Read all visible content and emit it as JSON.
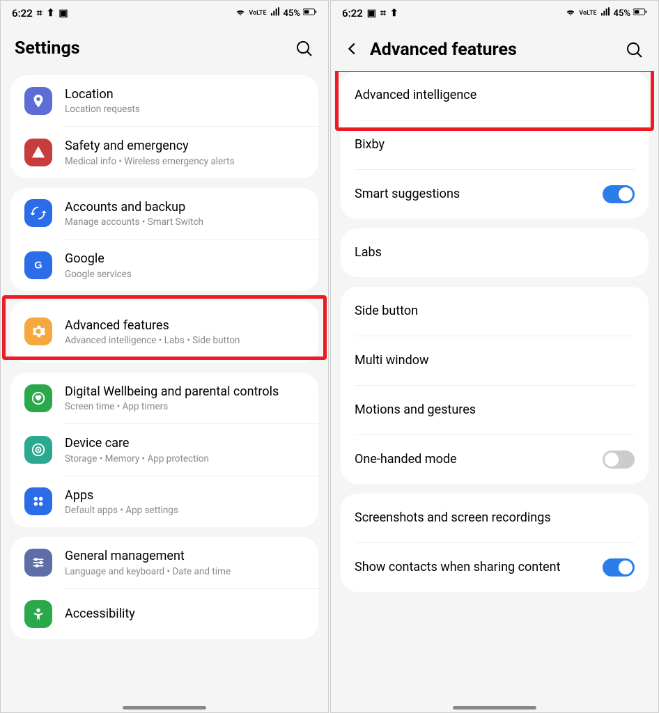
{
  "status": {
    "time": "6:22",
    "battery": "45%",
    "volte": "VoLTE"
  },
  "left": {
    "title": "Settings",
    "groups": [
      {
        "rows": [
          {
            "id": "location",
            "title": "Location",
            "sub": "Location requests",
            "icon": "location",
            "color": "ic-blue"
          },
          {
            "id": "safety",
            "title": "Safety and emergency",
            "sub": "Medical info  •  Wireless emergency alerts",
            "icon": "alert",
            "color": "ic-red"
          }
        ]
      },
      {
        "rows": [
          {
            "id": "accounts",
            "title": "Accounts and backup",
            "sub": "Manage accounts  •  Smart Switch",
            "icon": "sync",
            "color": "ic-dblue"
          },
          {
            "id": "google",
            "title": "Google",
            "sub": "Google services",
            "icon": "google",
            "color": "ic-google"
          }
        ]
      },
      {
        "rows": [
          {
            "id": "advanced",
            "title": "Advanced features",
            "sub": "Advanced intelligence  •  Labs  •  Side button",
            "icon": "gear",
            "color": "ic-orange",
            "highlighted": true
          }
        ]
      },
      {
        "rows": [
          {
            "id": "wellbeing",
            "title": "Digital Wellbeing and parental controls",
            "sub": "Screen time  •  App timers",
            "icon": "heart",
            "color": "ic-green"
          },
          {
            "id": "devicecare",
            "title": "Device care",
            "sub": "Storage  •  Memory  •  App protection",
            "icon": "target",
            "color": "ic-teal"
          },
          {
            "id": "apps",
            "title": "Apps",
            "sub": "Default apps  •  App settings",
            "icon": "grid",
            "color": "ic-dblue"
          }
        ]
      },
      {
        "rows": [
          {
            "id": "general",
            "title": "General management",
            "sub": "Language and keyboard  •  Date and time",
            "icon": "sliders",
            "color": "ic-slate"
          },
          {
            "id": "accessibility",
            "title": "Accessibility",
            "sub": "",
            "icon": "person",
            "color": "ic-green2"
          }
        ]
      }
    ]
  },
  "right": {
    "title": "Advanced features",
    "groups": [
      {
        "rows": [
          {
            "id": "advintel",
            "title": "Advanced intelligence",
            "highlighted": true
          },
          {
            "id": "bixby",
            "title": "Bixby"
          },
          {
            "id": "smart",
            "title": "Smart suggestions",
            "toggle": "on"
          }
        ]
      },
      {
        "rows": [
          {
            "id": "labs",
            "title": "Labs"
          }
        ]
      },
      {
        "rows": [
          {
            "id": "sidebtn",
            "title": "Side button"
          },
          {
            "id": "multiwin",
            "title": "Multi window"
          },
          {
            "id": "motions",
            "title": "Motions and gestures"
          },
          {
            "id": "onehand",
            "title": "One-handed mode",
            "toggle": "off"
          }
        ]
      },
      {
        "rows": [
          {
            "id": "screenshots",
            "title": "Screenshots and screen recordings"
          },
          {
            "id": "sharecontacts",
            "title": "Show contacts when sharing content",
            "toggle": "on"
          }
        ]
      }
    ]
  }
}
